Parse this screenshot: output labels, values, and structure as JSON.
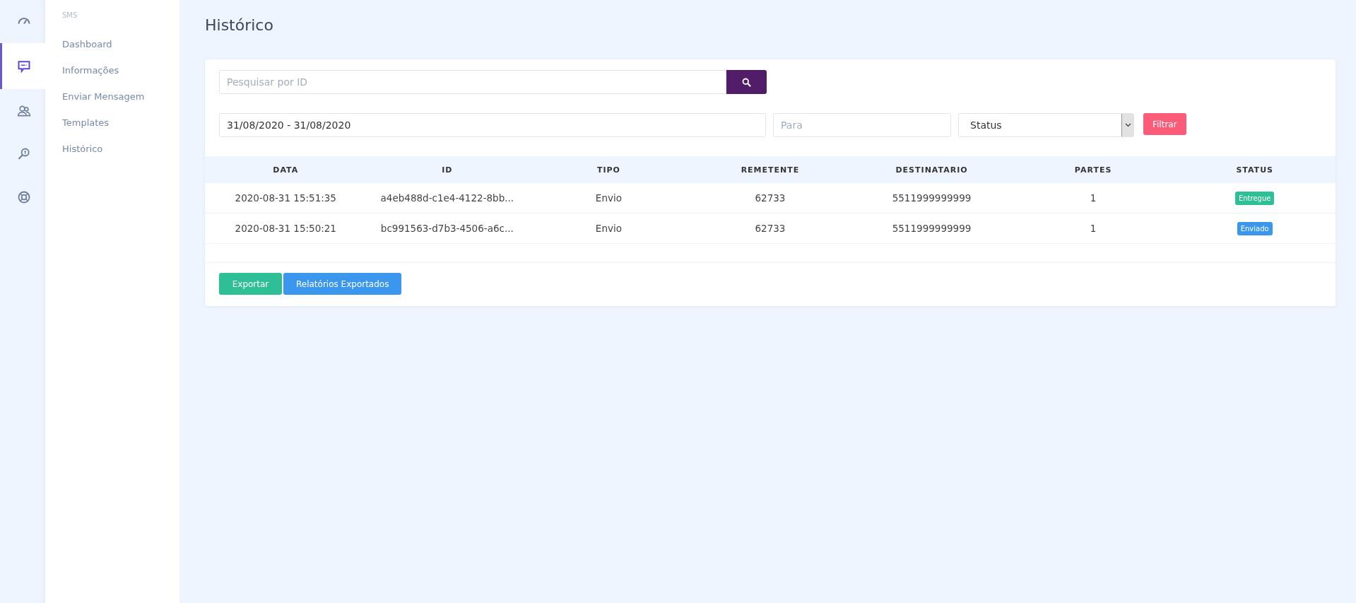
{
  "icon_rail": [
    {
      "kind": "gauge",
      "selected": false
    },
    {
      "kind": "message",
      "selected": true
    },
    {
      "kind": "users",
      "selected": false
    },
    {
      "kind": "magnifier",
      "selected": false
    },
    {
      "kind": "lifebuoy",
      "selected": false
    }
  ],
  "sidebar": {
    "heading": "SMS",
    "items": [
      "Dashboard",
      "Informações",
      "Enviar Mensagem",
      "Templates",
      "Histórico"
    ]
  },
  "page_title": "Histórico",
  "search": {
    "placeholder": "Pesquisar por ID"
  },
  "filters": {
    "date_range": "31/08/2020 - 31/08/2020",
    "to_placeholder": "Para",
    "status_select": "Status",
    "filter_button": "Filtrar"
  },
  "table": {
    "columns": [
      "DATA",
      "ID",
      "TIPO",
      "REMETENTE",
      "DESTINATARIO",
      "PARTES",
      "STATUS"
    ],
    "rows": [
      {
        "cells": [
          "2020-08-31 15:51:35",
          "a4eb488d-c1e4-4122-8bb...",
          "Envio",
          "62733",
          "5511999999999",
          "1"
        ],
        "status": "Entregue",
        "color": "#2ebf96"
      },
      {
        "cells": [
          "2020-08-31 15:50:21",
          "bc991563-d7b3-4506-a6c...",
          "Envio",
          "62733",
          "5511999999999",
          "1"
        ],
        "status": "Enviado",
        "color": "#3a97ed"
      }
    ]
  },
  "buttons": [
    "Exportar",
    "Relatórios Exportados"
  ]
}
